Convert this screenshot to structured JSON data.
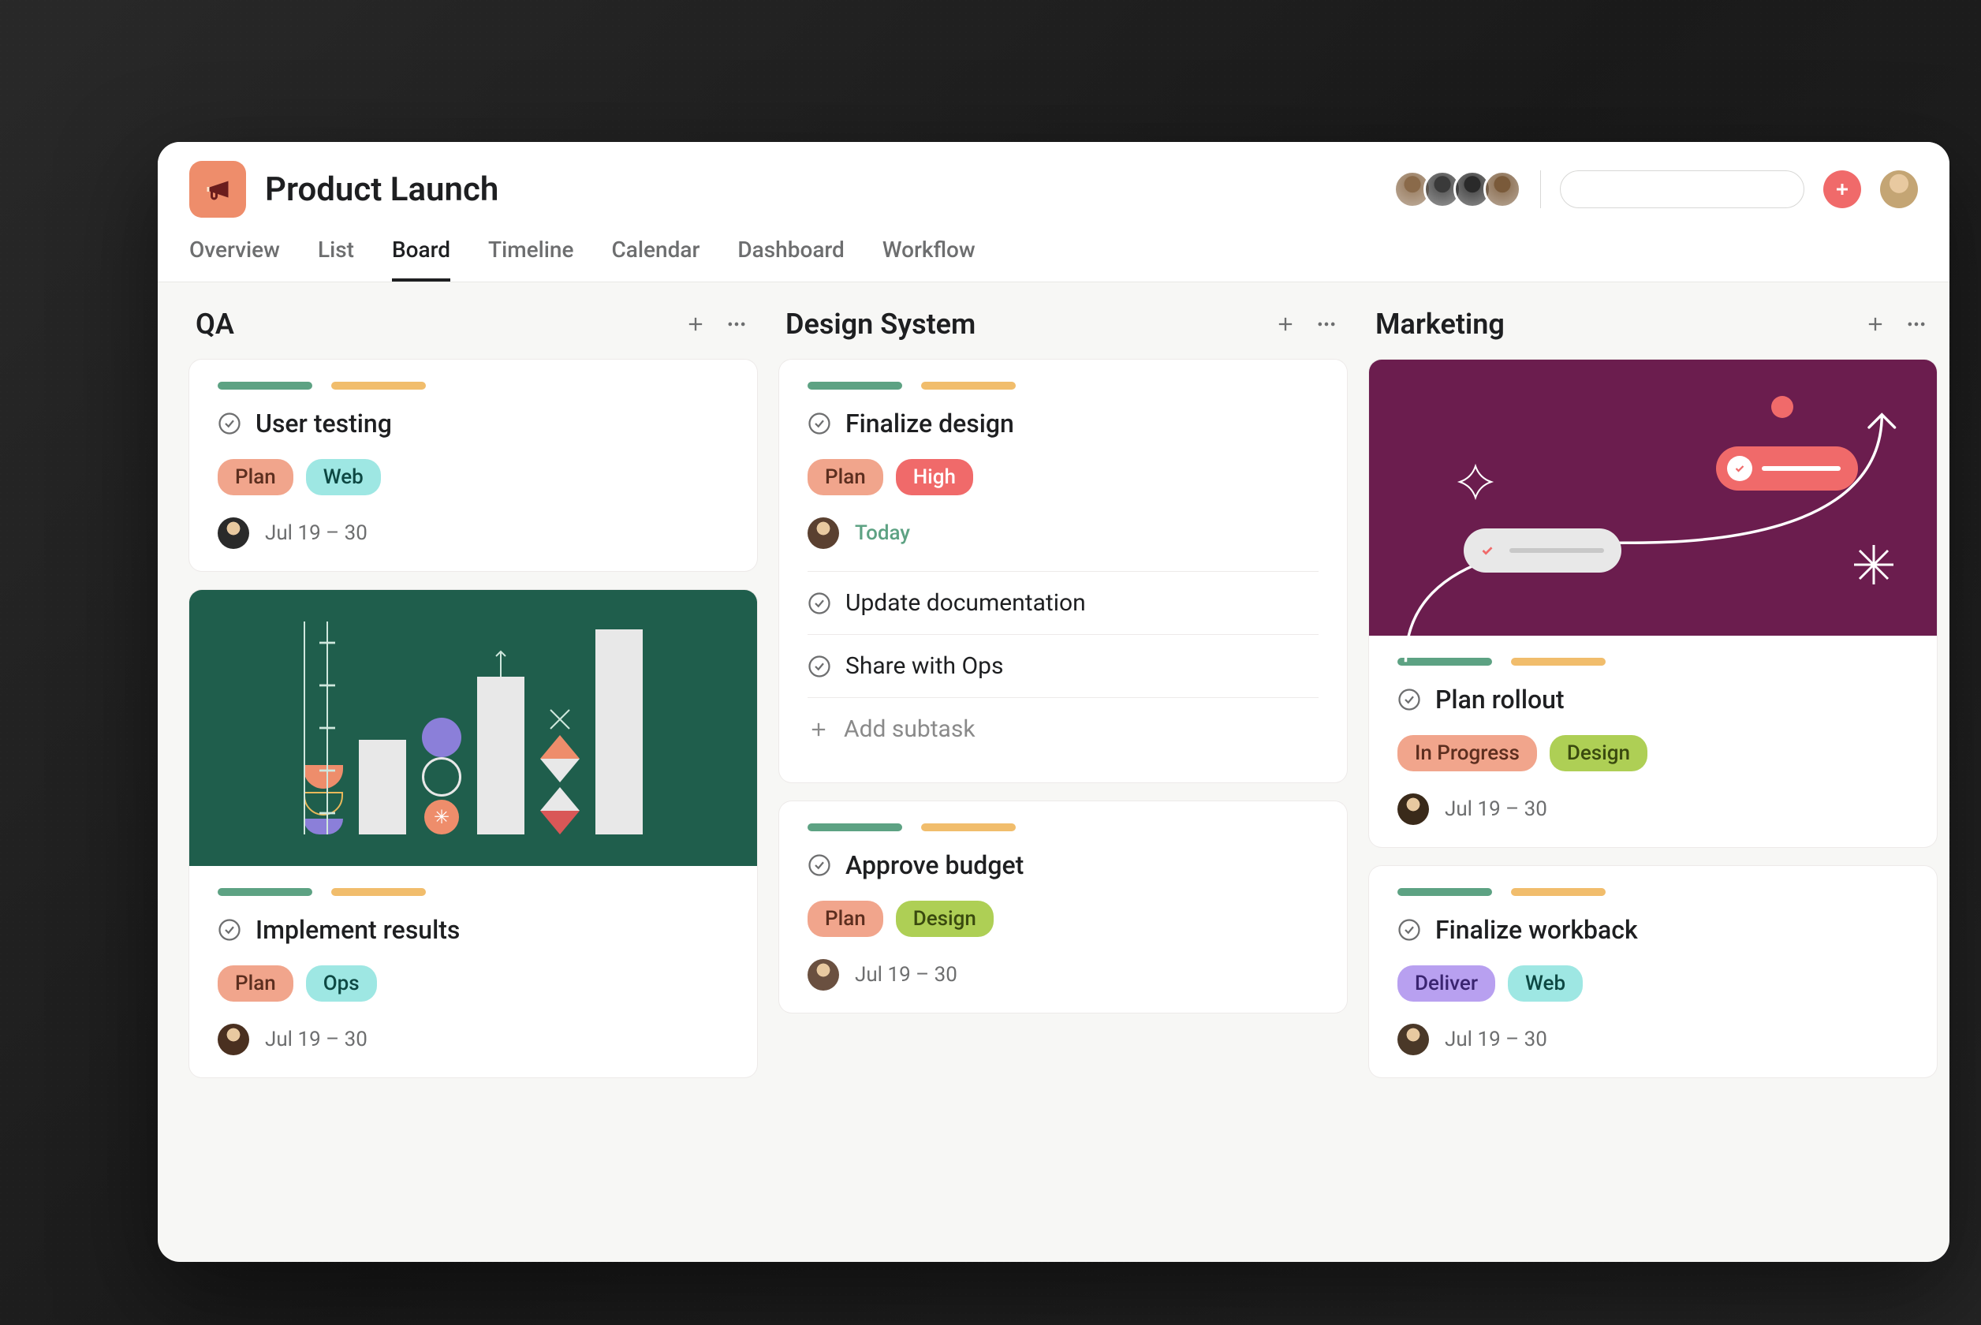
{
  "project": {
    "title": "Product Launch"
  },
  "tabs": [
    "Overview",
    "List",
    "Board",
    "Timeline",
    "Calendar",
    "Dashboard",
    "Workflow"
  ],
  "active_tab": "Board",
  "columns": [
    {
      "name": "QA",
      "cards": [
        {
          "title": "User testing",
          "tags": [
            {
              "label": "Plan",
              "class": "plan"
            },
            {
              "label": "Web",
              "class": "web"
            }
          ],
          "due": "Jul 19 – 30",
          "avatar_color": "#2a2a2a"
        },
        {
          "has_image": "chart",
          "title": "Implement results",
          "tags": [
            {
              "label": "Plan",
              "class": "plan"
            },
            {
              "label": "Ops",
              "class": "ops"
            }
          ],
          "due": "Jul 19 – 30",
          "avatar_color": "#4a3020"
        }
      ]
    },
    {
      "name": "Design System",
      "cards": [
        {
          "title": "Finalize design",
          "tags": [
            {
              "label": "Plan",
              "class": "plan"
            },
            {
              "label": "High",
              "class": "high"
            }
          ],
          "due": "Today",
          "due_today": true,
          "avatar_color": "#5a4030",
          "subtasks": [
            {
              "title": "Update documentation"
            },
            {
              "title": "Share with Ops"
            }
          ],
          "add_subtask_label": "Add subtask"
        },
        {
          "title": "Approve budget",
          "tags": [
            {
              "label": "Plan",
              "class": "plan"
            },
            {
              "label": "Design",
              "class": "design"
            }
          ],
          "due": "Jul 19 – 30",
          "avatar_color": "#6a5040"
        }
      ]
    },
    {
      "name": "Marketing",
      "cards": [
        {
          "has_image": "marketing",
          "title": "Plan rollout",
          "tags": [
            {
              "label": "In Progress",
              "class": "inprogress"
            },
            {
              "label": "Design",
              "class": "design"
            }
          ],
          "due": "Jul 19 – 30",
          "avatar_color": "#3a2a1a"
        },
        {
          "title": "Finalize workback",
          "tags": [
            {
              "label": "Deliver",
              "class": "deliver"
            },
            {
              "label": "Web",
              "class": "web"
            }
          ],
          "due": "Jul 19 – 30",
          "avatar_color": "#4a3828"
        }
      ]
    }
  ],
  "team_avatars": [
    "#8a6a4a",
    "#3a3a3a",
    "#2a2a2a",
    "#7a5a3a"
  ]
}
